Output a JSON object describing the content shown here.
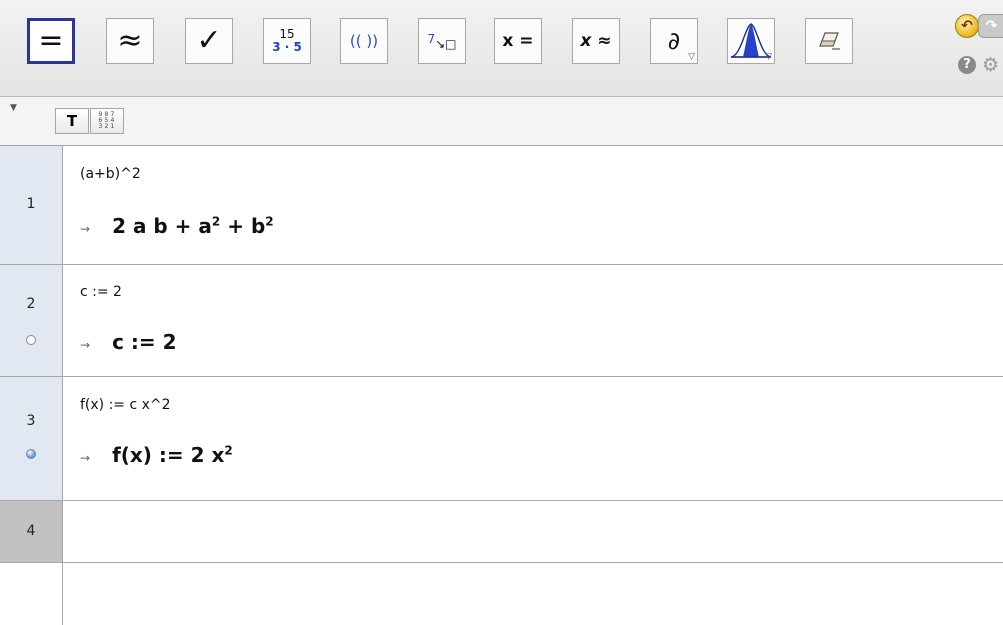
{
  "toolbar": {
    "buttons": [
      {
        "name": "evaluate",
        "glyph": "="
      },
      {
        "name": "numeric",
        "glyph": "≈"
      },
      {
        "name": "keep-input",
        "glyph": "✓"
      },
      {
        "name": "factor",
        "num": "15",
        "den": "3 · 5"
      },
      {
        "name": "expand",
        "glyph": "(( ))"
      },
      {
        "name": "substitute",
        "sup": "7",
        "glyph": "↘□"
      },
      {
        "name": "solve",
        "glyph": "x ="
      },
      {
        "name": "solve-numerically",
        "glyph": "x ≈"
      },
      {
        "name": "derivative",
        "glyph": "∂"
      },
      {
        "name": "probability",
        "glyph": ""
      },
      {
        "name": "delete",
        "glyph": ""
      }
    ],
    "undo": "↶",
    "redo": "↷",
    "help": "?",
    "settings": "⚙"
  },
  "stylebar": {
    "text_button": "T",
    "keypad_digits": [
      "9",
      "8",
      "7",
      "6",
      "5",
      "4",
      "3",
      "2",
      "1"
    ]
  },
  "cas": {
    "rows": [
      {
        "number": "1",
        "input": "(a+b)^2",
        "output": "2 a b + a",
        "output_sup1": "2",
        "output_tail": " + b",
        "output_sup2": "2",
        "marble": ""
      },
      {
        "number": "2",
        "input": "c := 2",
        "output": "c := 2",
        "marble": "hidden"
      },
      {
        "number": "3",
        "input": "f(x) := c x^2",
        "output": "f(x) := 2 x",
        "output_sup1": "2",
        "marble": "shown"
      },
      {
        "number": "4",
        "input": "",
        "output": "",
        "marble": ""
      }
    ],
    "arrow": "→"
  }
}
